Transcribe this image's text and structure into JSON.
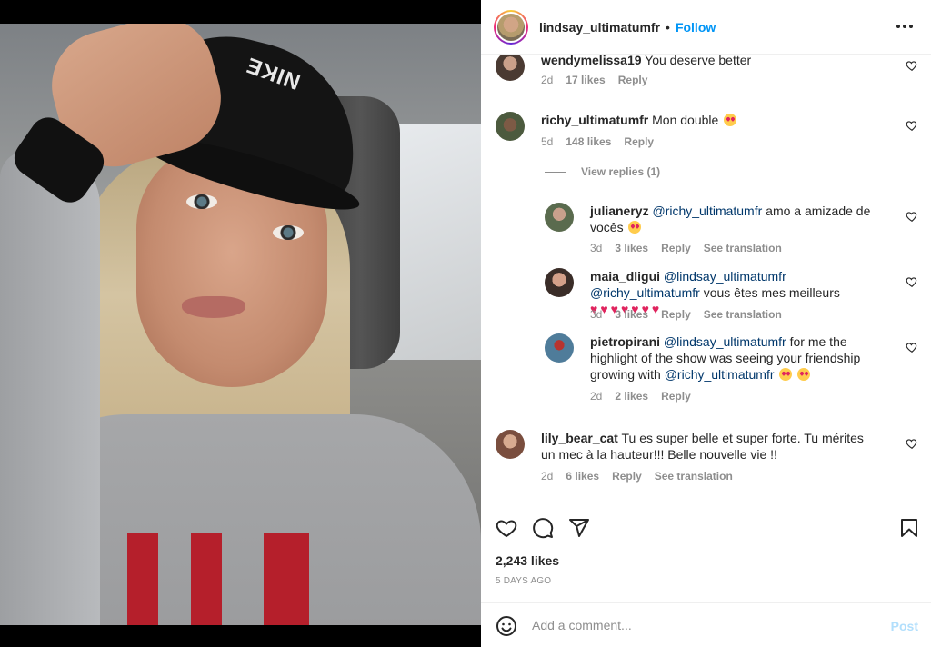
{
  "header": {
    "username": "lindsay_ultimatumfr",
    "separator": "•",
    "follow_label": "Follow"
  },
  "photo": {
    "cap_logo": "NIKE"
  },
  "comments": [
    {
      "username": "wendymelissa19",
      "text": "You deserve better",
      "age": "2d",
      "likes": "17 likes",
      "reply": "Reply"
    },
    {
      "username": "richy_ultimatumfr",
      "text": "Mon double",
      "age": "5d",
      "likes": "148 likes",
      "reply": "Reply"
    }
  ],
  "view_replies": "View replies (1)",
  "replies": [
    {
      "username": "julianeryz",
      "mention": "@richy_ultimatumfr",
      "text": "amo a amizade de vocês",
      "age": "3d",
      "likes": "3 likes",
      "reply": "Reply",
      "translate": "See translation"
    },
    {
      "username": "maia_dligui",
      "mention1": "@lindsay_ultimatumfr",
      "mention2": "@richy_ultimatumfr",
      "text": "vous êtes mes meilleurs",
      "hearts": "♥♥♥♥♥♥♥",
      "age": "3d",
      "likes": "3 likes",
      "reply": "Reply",
      "translate": "See translation"
    },
    {
      "username": "pietropirani",
      "mention1": "@lindsay_ultimatumfr",
      "text1": "for me the highlight of the show was seeing your friendship growing with",
      "mention2": "@richy_ultimatumfr",
      "age": "2d",
      "likes": "2 likes",
      "reply": "Reply"
    }
  ],
  "last_comment": {
    "username": "lily_bear_cat",
    "text": "Tu es super belle et super forte. Tu mérites un mec à la hauteur!!! Belle nouvelle vie !!",
    "age": "2d",
    "likes": "6 likes",
    "reply": "Reply",
    "translate": "See translation"
  },
  "stats": {
    "likes": "2,243 likes",
    "ago": "5 DAYS AGO"
  },
  "add_comment": {
    "placeholder": "Add a comment...",
    "post_label": "Post"
  },
  "colors": {
    "link": "#0095f6",
    "mention": "#00376b",
    "muted": "#8e8e8e",
    "post_disabled": "#b2dffc"
  }
}
